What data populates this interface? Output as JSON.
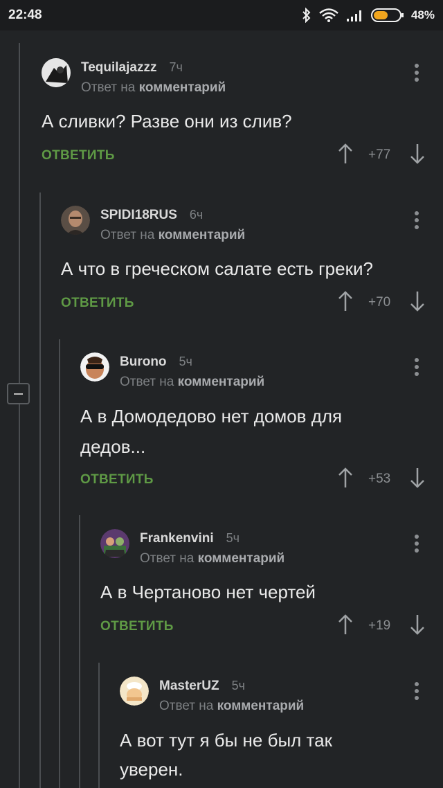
{
  "status_bar": {
    "time": "22:48",
    "battery_percent": "48%",
    "battery_level": 0.48,
    "icons": [
      "bluetooth-icon",
      "wifi-icon",
      "signal-icon",
      "battery-icon"
    ]
  },
  "colors": {
    "background": "#222426",
    "reply_green": "#5f9a45",
    "muted_text": "#7d8083"
  },
  "comments": [
    {
      "author": "Tequilajazzz",
      "time": "7ч",
      "reply_prefix": "Ответ на",
      "reply_target": "комментарий",
      "text": "А сливки? Разве они из слив?",
      "reply_label": "ОТВЕТИТЬ",
      "score": "+77"
    },
    {
      "author": "SPIDI18RUS",
      "time": "6ч",
      "reply_prefix": "Ответ на",
      "reply_target": "комментарий",
      "text": "А что в греческом салате есть греки?",
      "reply_label": "ОТВЕТИТЬ",
      "score": "+70"
    },
    {
      "author": "Burono",
      "time": "5ч",
      "reply_prefix": "Ответ на",
      "reply_target": "комментарий",
      "text_line1": "А в Домодедово нет домов для",
      "text_line2": "дедов...",
      "reply_label": "ОТВЕТИТЬ",
      "score": "+53"
    },
    {
      "author": "Frankenvini",
      "time": "5ч",
      "reply_prefix": "Ответ на",
      "reply_target": "комментарий",
      "text": "А в Чертаново нет чертей",
      "reply_label": "ОТВЕТИТЬ",
      "score": "+19"
    },
    {
      "author": "MasterUZ",
      "time": "5ч",
      "reply_prefix": "Ответ на",
      "reply_target": "комментарий",
      "text_line1": "А вот тут я бы не был так",
      "text_line2": "уверен."
    }
  ]
}
